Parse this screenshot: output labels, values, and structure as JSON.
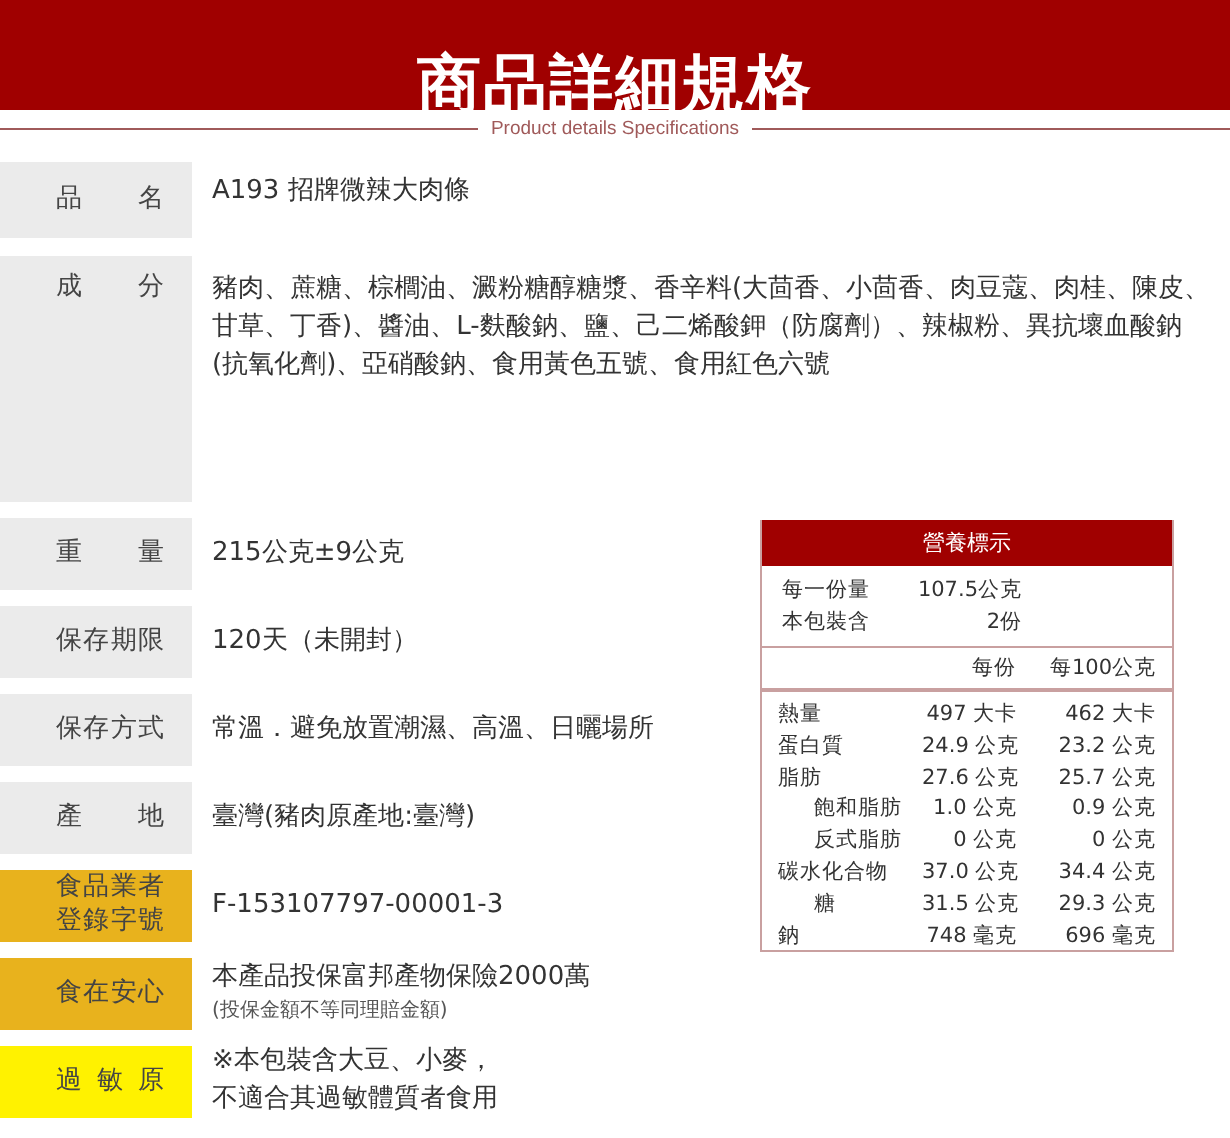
{
  "header": {
    "title": "商品詳細規格",
    "subtitle": "Product details Specifications"
  },
  "top_rows": [
    {
      "label": "品 名",
      "value": "A193 招牌微辣大肉條"
    },
    {
      "label": "成 分",
      "value": "豬肉、蔗糖、棕櫚油、澱粉糖醇糖漿、香辛料(大茴香、小茴香、肉豆蔻、肉桂、陳皮、甘草、丁香)、醬油、L-麩酸鈉、鹽、己二烯酸鉀（防腐劑）、辣椒粉、異抗壞血酸鈉(抗氧化劑)、亞硝酸鈉、食用黃色五號、食用紅色六號"
    }
  ],
  "rows": [
    {
      "label": "重 量",
      "kind": "plain",
      "lines": [
        "215公克±9公克"
      ]
    },
    {
      "label": "保存期限",
      "kind": "plain",
      "lines": [
        "120天（未開封）"
      ]
    },
    {
      "label": "保存方式",
      "kind": "plain",
      "lines": [
        "常溫．避免放置潮濕、高溫、日曬場所"
      ]
    },
    {
      "label": "產 地",
      "kind": "plain",
      "lines": [
        "臺灣(豬肉原產地:臺灣)"
      ]
    },
    {
      "label": "食品業者登錄字號",
      "kind": "notice",
      "lines": [
        "F-153107797-00001-3"
      ]
    },
    {
      "label": "食在安心",
      "kind": "notice",
      "lines": [
        "本產品投保富邦產物保險2000萬"
      ],
      "note": "(投保金額不等同理賠金額)"
    },
    {
      "label": "過 敏 原",
      "kind": "allergen",
      "lines": [
        "※本包裝含大豆、小麥，",
        "不適合其過敏體質者食用"
      ]
    }
  ],
  "nutrition": {
    "title": "營養標示",
    "serving": [
      {
        "name": "每一份量",
        "value": "107.5公克"
      },
      {
        "name": "本包裝含",
        "value": "2份"
      }
    ],
    "columns": [
      "每份",
      "每100公克"
    ],
    "nutrients": [
      {
        "name": "熱量",
        "per_serving": "497 大卡",
        "per_100g": "462 大卡"
      },
      {
        "name": "蛋白質",
        "per_serving": "24.9 公克",
        "per_100g": "23.2 公克"
      },
      {
        "name": "脂肪",
        "per_serving": "27.6 公克",
        "per_100g": "25.7 公克",
        "children": [
          {
            "name": "飽和脂肪",
            "per_serving": "1.0 公克",
            "per_100g": "0.9 公克"
          },
          {
            "name": "反式脂肪",
            "per_serving": "0 公克",
            "per_100g": "0 公克"
          }
        ]
      },
      {
        "name": "碳水化合物",
        "per_serving": "37.0 公克",
        "per_100g": "34.4 公克",
        "children": [
          {
            "name": "糖",
            "per_serving": "31.5 公克",
            "per_100g": "29.3 公克"
          }
        ]
      },
      {
        "name": "鈉",
        "per_serving": "748 毫克",
        "per_100g": "696 毫克"
      }
    ]
  }
}
